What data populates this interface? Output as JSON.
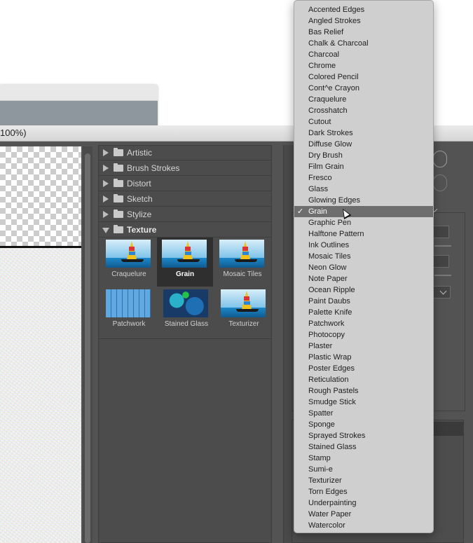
{
  "window": {
    "zoom_label": "100%)"
  },
  "categories": [
    {
      "label": "Artistic",
      "open": false
    },
    {
      "label": "Brush Strokes",
      "open": false
    },
    {
      "label": "Distort",
      "open": false
    },
    {
      "label": "Sketch",
      "open": false
    },
    {
      "label": "Stylize",
      "open": false
    },
    {
      "label": "Texture",
      "open": true
    }
  ],
  "texture_thumbs": [
    {
      "label": "Craquelure",
      "selected": false
    },
    {
      "label": "Grain",
      "selected": true
    },
    {
      "label": "Mosaic Tiles",
      "selected": false
    },
    {
      "label": "Patchwork",
      "selected": false
    },
    {
      "label": "Stained Glass",
      "selected": false
    },
    {
      "label": "Texturizer",
      "selected": false
    }
  ],
  "filter_menu": {
    "selected": "Grain",
    "items": [
      "Accented Edges",
      "Angled Strokes",
      "Bas Relief",
      "Chalk & Charcoal",
      "Charcoal",
      "Chrome",
      "Colored Pencil",
      "Cont^e Crayon",
      "Craquelure",
      "Crosshatch",
      "Cutout",
      "Dark Strokes",
      "Diffuse Glow",
      "Dry Brush",
      "Film Grain",
      "Fresco",
      "Glass",
      "Glowing Edges",
      "Grain",
      "Graphic Pen",
      "Halftone Pattern",
      "Ink Outlines",
      "Mosaic Tiles",
      "Neon Glow",
      "Note Paper",
      "Ocean Ripple",
      "Paint Daubs",
      "Palette Knife",
      "Patchwork",
      "Photocopy",
      "Plaster",
      "Plastic Wrap",
      "Poster Edges",
      "Reticulation",
      "Rough Pastels",
      "Smudge Stick",
      "Spatter",
      "Sponge",
      "Sprayed Strokes",
      "Stained Glass",
      "Stamp",
      "Sumi-e",
      "Texturizer",
      "Torn Edges",
      "Underpainting",
      "Water Paper",
      "Watercolor"
    ]
  }
}
